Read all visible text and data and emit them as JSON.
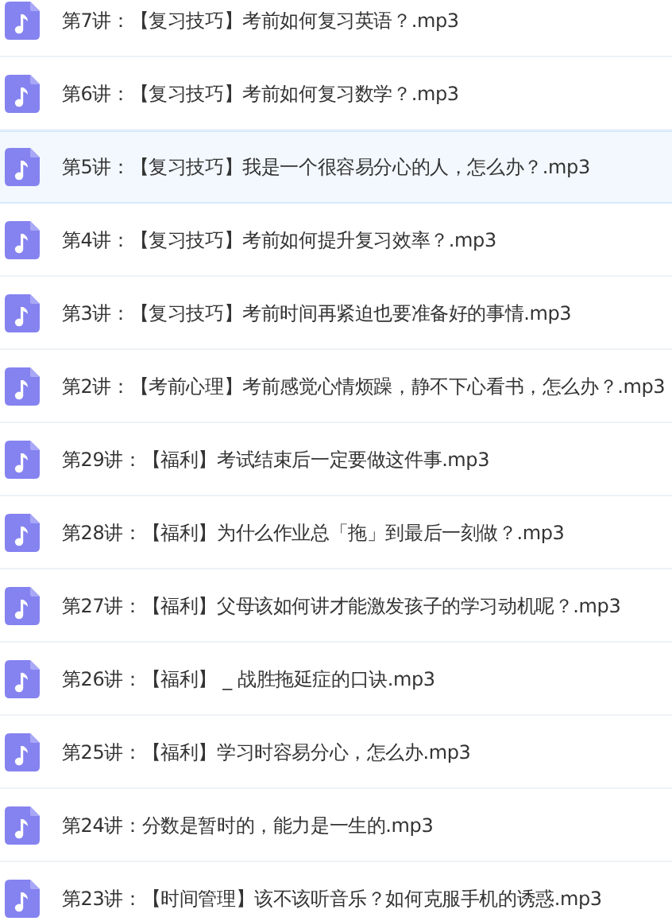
{
  "files": [
    {
      "name": "第7讲：【复习技巧】考前如何复习英语？.mp3",
      "selected": false
    },
    {
      "name": "第6讲：【复习技巧】考前如何复习数学？.mp3",
      "selected": false
    },
    {
      "name": "第5讲：【复习技巧】我是一个很容易分心的人，怎么办？.mp3",
      "selected": true
    },
    {
      "name": "第4讲：【复习技巧】考前如何提升复习效率？.mp3",
      "selected": false
    },
    {
      "name": "第3讲：【复习技巧】考前时间再紧迫也要准备好的事情.mp3",
      "selected": false
    },
    {
      "name": "第2讲：【考前心理】考前感觉心情烦躁，静不下心看书，怎么办？.mp3",
      "selected": false
    },
    {
      "name": "第29讲：【福利】考试结束后一定要做这件事.mp3",
      "selected": false
    },
    {
      "name": "第28讲：【福利】为什么作业总「拖」到最后一刻做？.mp3",
      "selected": false
    },
    {
      "name": "第27讲：【福利】父母该如何讲才能激发孩子的学习动机呢？.mp3",
      "selected": false
    },
    {
      "name": "第26讲：【福利】 _ 战胜拖延症的口诀.mp3",
      "selected": false
    },
    {
      "name": "第25讲：【福利】学习时容易分心，怎么办.mp3",
      "selected": false
    },
    {
      "name": "第24讲：分数是暂时的，能力是一生的.mp3",
      "selected": false
    },
    {
      "name": "第23讲：【时间管理】该不该听音乐？如何克服手机的诱惑.mp3",
      "selected": false
    }
  ]
}
